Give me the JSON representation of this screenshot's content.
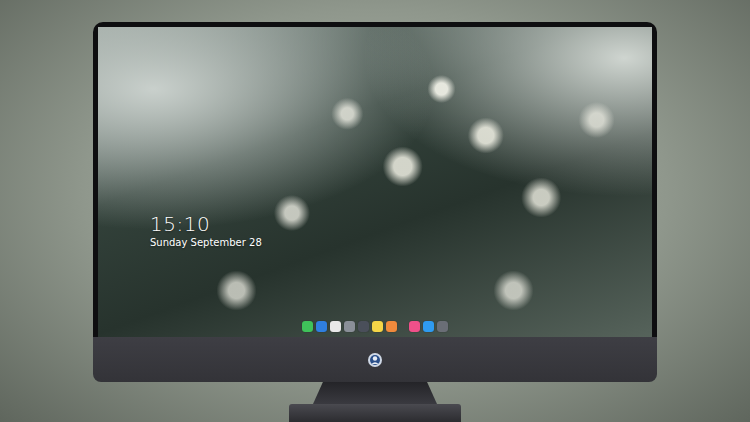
{
  "lock_screen": {
    "time": "15:10",
    "date": "Sunday September 28"
  },
  "dock": {
    "groups": [
      {
        "items": [
          {
            "color": "#3fc25a"
          },
          {
            "color": "#2f7fe0"
          },
          {
            "color": "#e8e8e8"
          },
          {
            "color": "#8a8f98"
          },
          {
            "color": "#4a4f5a"
          },
          {
            "color": "#f5d547"
          },
          {
            "color": "#f08a3c"
          }
        ]
      },
      {
        "items": [
          {
            "color": "#f0508a"
          },
          {
            "color": "#2f9bf0"
          },
          {
            "color": "#6a6e76"
          }
        ]
      }
    ]
  }
}
